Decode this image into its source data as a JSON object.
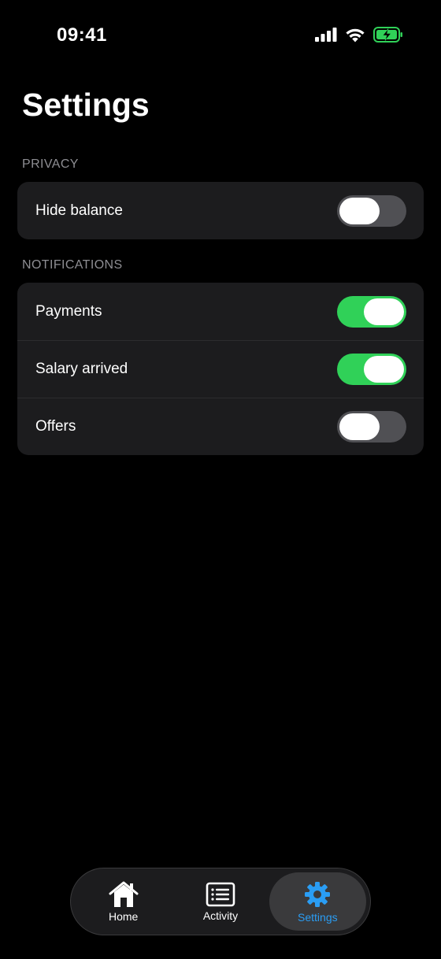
{
  "status_bar": {
    "time": "09:41",
    "icons": [
      "signal-icon",
      "wifi-icon",
      "battery-charging-icon"
    ],
    "battery_color": "#30d158"
  },
  "header": {
    "title": "Settings"
  },
  "sections": [
    {
      "title": "PRIVACY",
      "rows": [
        {
          "label": "Hide balance",
          "toggle_on": false
        }
      ]
    },
    {
      "title": "NOTIFICATIONS",
      "rows": [
        {
          "label": "Payments",
          "toggle_on": true
        },
        {
          "label": "Salary arrived",
          "toggle_on": true
        },
        {
          "label": "Offers",
          "toggle_on": false
        }
      ]
    }
  ],
  "tab_bar": {
    "tabs": [
      {
        "label": "Home",
        "icon": "home-icon",
        "active": false
      },
      {
        "label": "Activity",
        "icon": "activity-list-icon",
        "active": false
      },
      {
        "label": "Settings",
        "icon": "gear-icon",
        "active": true
      }
    ],
    "active_color": "#2a9df4"
  },
  "colors": {
    "background": "#000000",
    "card": "#1c1c1e",
    "toggle_on": "#30d158",
    "toggle_off": "#505054",
    "section_header": "#8e8e93"
  }
}
